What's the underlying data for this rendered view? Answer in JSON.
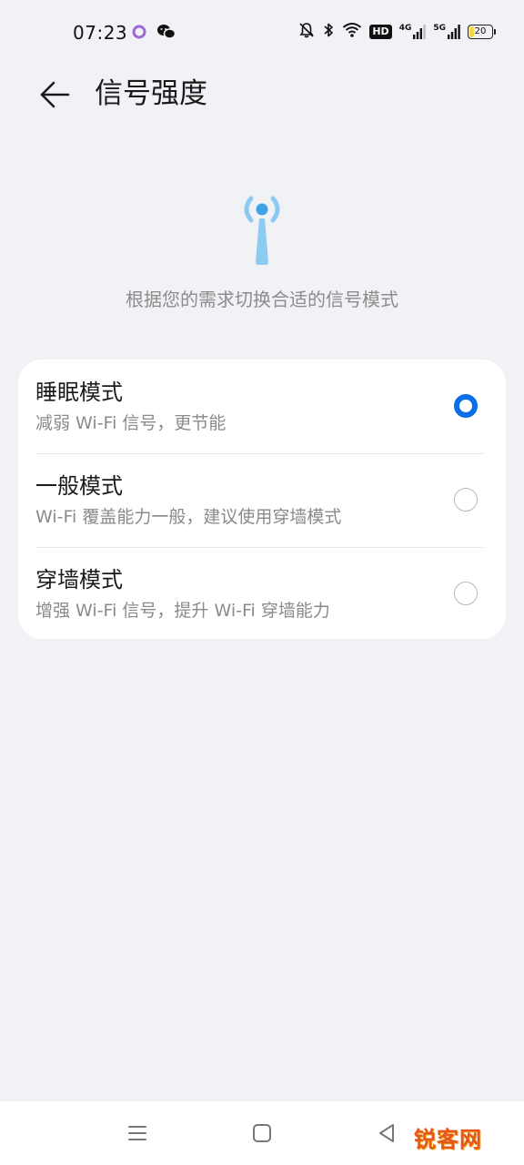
{
  "status_bar": {
    "time": "07:23",
    "hd_label": "HD",
    "net1_label": "4G",
    "net2_label": "5G",
    "battery_level": "20"
  },
  "header": {
    "title": "信号强度"
  },
  "hero": {
    "description": "根据您的需求切换合适的信号模式",
    "icon": "signal-tower-icon"
  },
  "options": [
    {
      "title": "睡眠模式",
      "description": "减弱 Wi-Fi 信号，更节能",
      "selected": true
    },
    {
      "title": "一般模式",
      "description": "Wi-Fi 覆盖能力一般，建议使用穿墙模式",
      "selected": false
    },
    {
      "title": "穿墙模式",
      "description": "增强 Wi-Fi 信号，提升 Wi-Fi 穿墙能力",
      "selected": false
    }
  ],
  "nav": {
    "watermark": "锐客网"
  },
  "colors": {
    "accent": "#0a6fe6",
    "background": "#f1f2f6",
    "card": "#ffffff",
    "hero_icon": "#8ccbf0"
  }
}
